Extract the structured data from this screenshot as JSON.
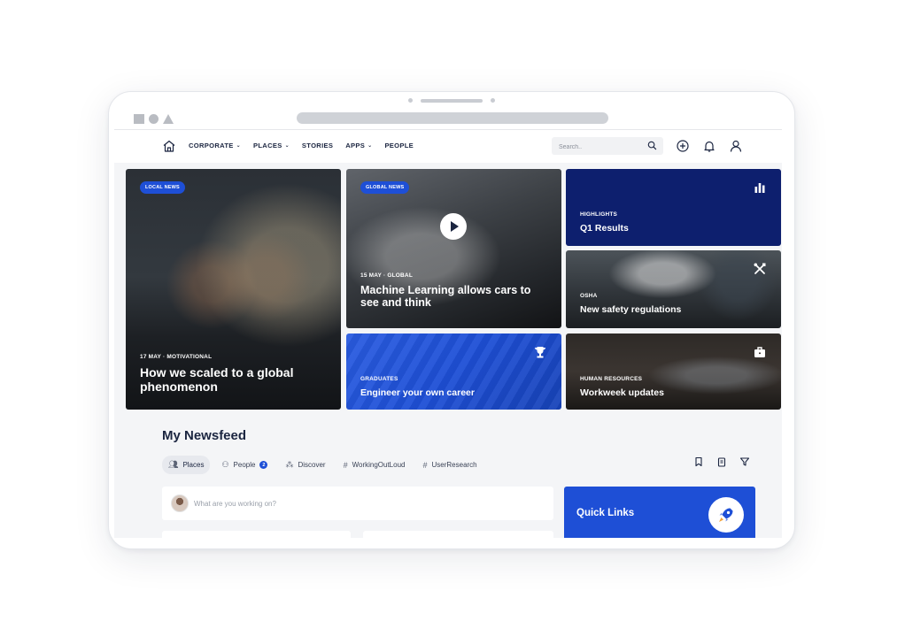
{
  "nav": {
    "items": [
      {
        "label": "CORPORATE",
        "dropdown": true
      },
      {
        "label": "PLACES",
        "dropdown": true
      },
      {
        "label": "STORIES",
        "dropdown": false
      },
      {
        "label": "APPS",
        "dropdown": true
      },
      {
        "label": "PEOPLE",
        "dropdown": false
      }
    ],
    "search_placeholder": "Search.."
  },
  "cards": {
    "local": {
      "tag": "LOCAL NEWS",
      "meta": "17 MAY · MOTIVATIONAL",
      "title": "How we scaled to a global phenomenon"
    },
    "global": {
      "tag": "GLOBAL NEWS",
      "meta": "15 MAY · GLOBAL",
      "title": "Machine Learning allows cars to see and think"
    },
    "highlights": {
      "meta": "HIGHLIGHTS",
      "title": "Q1 Results",
      "icon": "bar-chart-icon"
    },
    "osha": {
      "meta": "OSHA",
      "title": "New safety regulations",
      "icon": "tools-icon"
    },
    "graduates": {
      "meta": "GRADUATES",
      "title": "Engineer your own career",
      "icon": "trophy-icon"
    },
    "hr": {
      "meta": "HUMAN RESOURCES",
      "title": "Workweek updates",
      "icon": "briefcase-icon"
    }
  },
  "newsfeed": {
    "title": "My Newsfeed",
    "filters": [
      {
        "label": "Places",
        "icon": "people-icon",
        "active": true
      },
      {
        "label": "People",
        "icon": "person-icon",
        "badge": "2"
      },
      {
        "label": "Discover",
        "icon": "group-icon"
      },
      {
        "label": "WorkingOutLoud",
        "icon": "hash-icon"
      },
      {
        "label": "UserResearch",
        "icon": "hash-icon"
      }
    ],
    "composer_placeholder": "What are you working on?"
  },
  "quick_links": {
    "title": "Quick Links",
    "icon": "rocket-icon"
  },
  "colors": {
    "primary": "#1e4fd6",
    "navy": "#0d1f6e",
    "text": "#1b2540"
  }
}
